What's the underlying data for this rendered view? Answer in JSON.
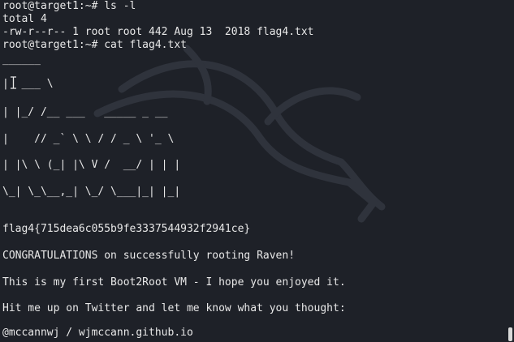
{
  "terminal": {
    "lines": [
      "root@target1:~# ls -l",
      "total 4",
      "-rw-r--r-- 1 root root 442 Aug 13  2018 flag4.txt",
      "root@target1:~# cat flag4.txt",
      "______",
      "|  ___ \\",
      "| |_/ /__ ___   _____ _ __",
      "|    // _` \\ \\ / / _ \\ '_ \\",
      "| |\\ \\ (_| |\\ V /  __/ | | |",
      "\\_| \\_\\__,_| \\_/ \\___|_| |_|",
      "flag4{715dea6c055b9fe3337544932f2941ce}",
      "CONGRATULATIONS on successfully rooting Raven!",
      "This is my first Boot2Root VM - I hope you enjoyed it.",
      "Hit me up on Twitter and let me know what you thought:",
      "@mccannwj / wjmccann.github.io"
    ]
  },
  "colors": {
    "background": "#1e2128",
    "text": "#e8e8e8",
    "watermark": "#2c3038"
  },
  "icons": {
    "wallpaper": "kali-dragon-icon",
    "cursor": "text-cursor-icon"
  }
}
